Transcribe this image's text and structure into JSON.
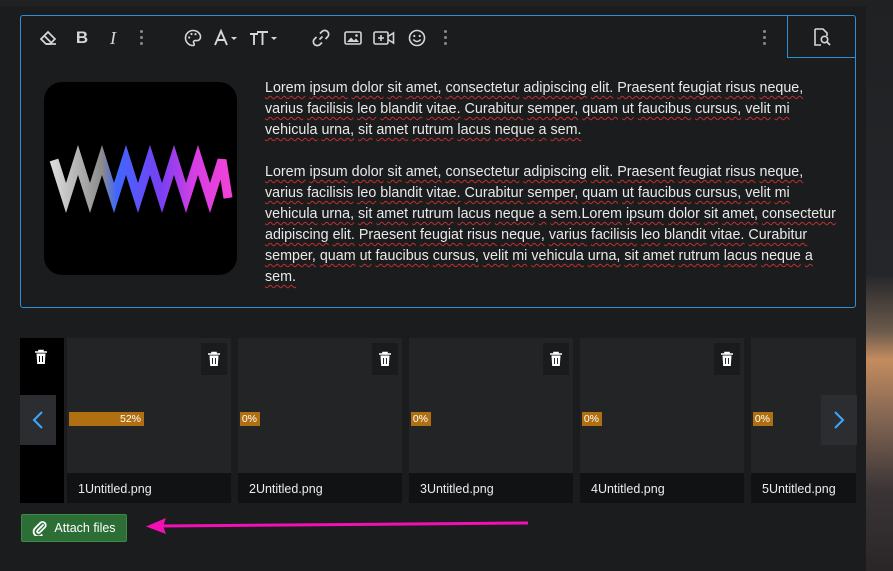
{
  "editor": {
    "toolbar": {
      "icons": [
        "eraser-icon",
        "bold-icon",
        "italic-icon",
        "more-vertical-icon",
        "palette-icon",
        "font-color-icon",
        "text-size-icon",
        "link-icon",
        "image-icon",
        "video-icon",
        "emoji-icon",
        "more-vertical-icon",
        "more-vertical-icon",
        "preview-icon"
      ],
      "bold_label": "B",
      "italic_label": "I"
    },
    "paragraphs": [
      "Lorem ipsum dolor sit amet, consectetur adipiscing elit. Praesent feugiat risus neque, varius facilisis leo blandit vitae. Curabitur semper, quam ut faucibus cursus, velit mi vehicula urna, sit amet rutrum lacus neque a sem.",
      "Lorem ipsum dolor sit amet, consectetur adipiscing elit. Praesent feugiat risus neque, varius facilisis leo blandit vitae. Curabitur semper, quam ut faucibus cursus, velit mi vehicula urna, sit amet rutrum lacus neque a sem.Lorem ipsum dolor sit amet, consectetur adipiscing elit. Praesent feugiat risus neque, varius facilisis leo blandit vitae. Curabitur semper, quam ut faucibus cursus, velit mi vehicula urna, sit amet rutrum lacus neque a sem."
    ],
    "border_color": "#2f8fd6"
  },
  "attachments": [
    {
      "name": "1Untitled.png",
      "progress_label": "52%",
      "progress": 0.52
    },
    {
      "name": "2Untitled.png",
      "progress_label": "0%",
      "progress": 0
    },
    {
      "name": "3Untitled.png",
      "progress_label": "0%",
      "progress": 0
    },
    {
      "name": "4Untitled.png",
      "progress_label": "0%",
      "progress": 0
    },
    {
      "name": "5Untitled.png",
      "progress_label": "0%",
      "progress": 0
    }
  ],
  "attach_button": {
    "label": "Attach files",
    "icon": "paperclip-icon",
    "color": "#2c6e35"
  },
  "progress_color": "#b07012",
  "annotation_arrow_color": "#f20fb4"
}
